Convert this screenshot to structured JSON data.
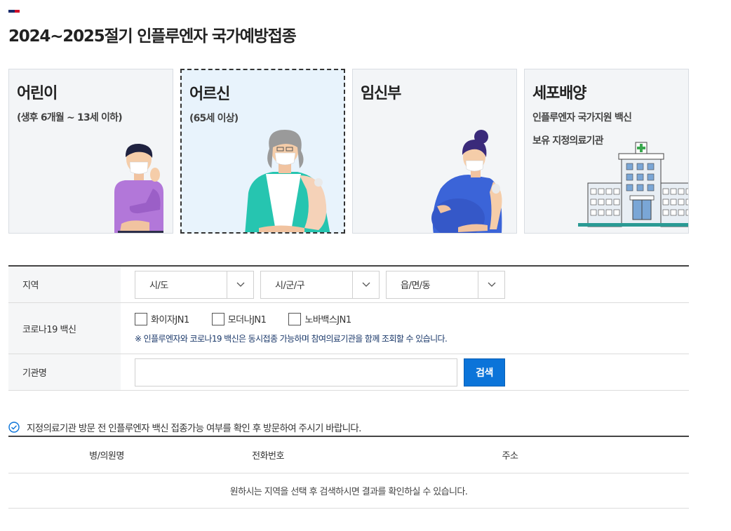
{
  "header": {
    "title": "2024~2025절기 인플루엔자 국가예방접종"
  },
  "cards": [
    {
      "title": "어린이",
      "subtitle": "(생후 6개월 ~ 13세 이하)",
      "subtitle2": "",
      "selected": false
    },
    {
      "title": "어르신",
      "subtitle": "(65세 이상)",
      "subtitle2": "",
      "selected": true
    },
    {
      "title": "임신부",
      "subtitle": "",
      "subtitle2": "",
      "selected": false
    },
    {
      "title": "세포배양",
      "subtitle": "인플루엔자 국가지원 백신",
      "subtitle2": "보유 지정의료기관",
      "selected": false
    }
  ],
  "search": {
    "region_label": "지역",
    "region_selects": [
      "시/도",
      "시/군/구",
      "읍/면/동"
    ],
    "covid_label": "코로나19 백신",
    "covid_options": [
      "화이자JN1",
      "모더나JN1",
      "노바백스JN1"
    ],
    "covid_note": "※ 인플루엔자와 코로나19 백신은 동시접종 가능하며 참여의료기관을 함께 조회할 수 있습니다.",
    "name_label": "기관명",
    "name_value": "",
    "search_button": "검색"
  },
  "notice": "지정의료기관 방문 전 인플루엔자 백신 접종가능 여부를 확인 후 방문하여 주시기 바랍니다.",
  "results": {
    "columns": [
      "병/의원명",
      "전화번호",
      "주소"
    ],
    "empty_message": "원하시는 지역을 선택 후 검색하시면 결과를 확인하실 수 있습니다."
  },
  "colors": {
    "accent": "#0b74d9",
    "selected_card_bg": "#e8f3fc",
    "note_text": "#1c3a6b"
  }
}
